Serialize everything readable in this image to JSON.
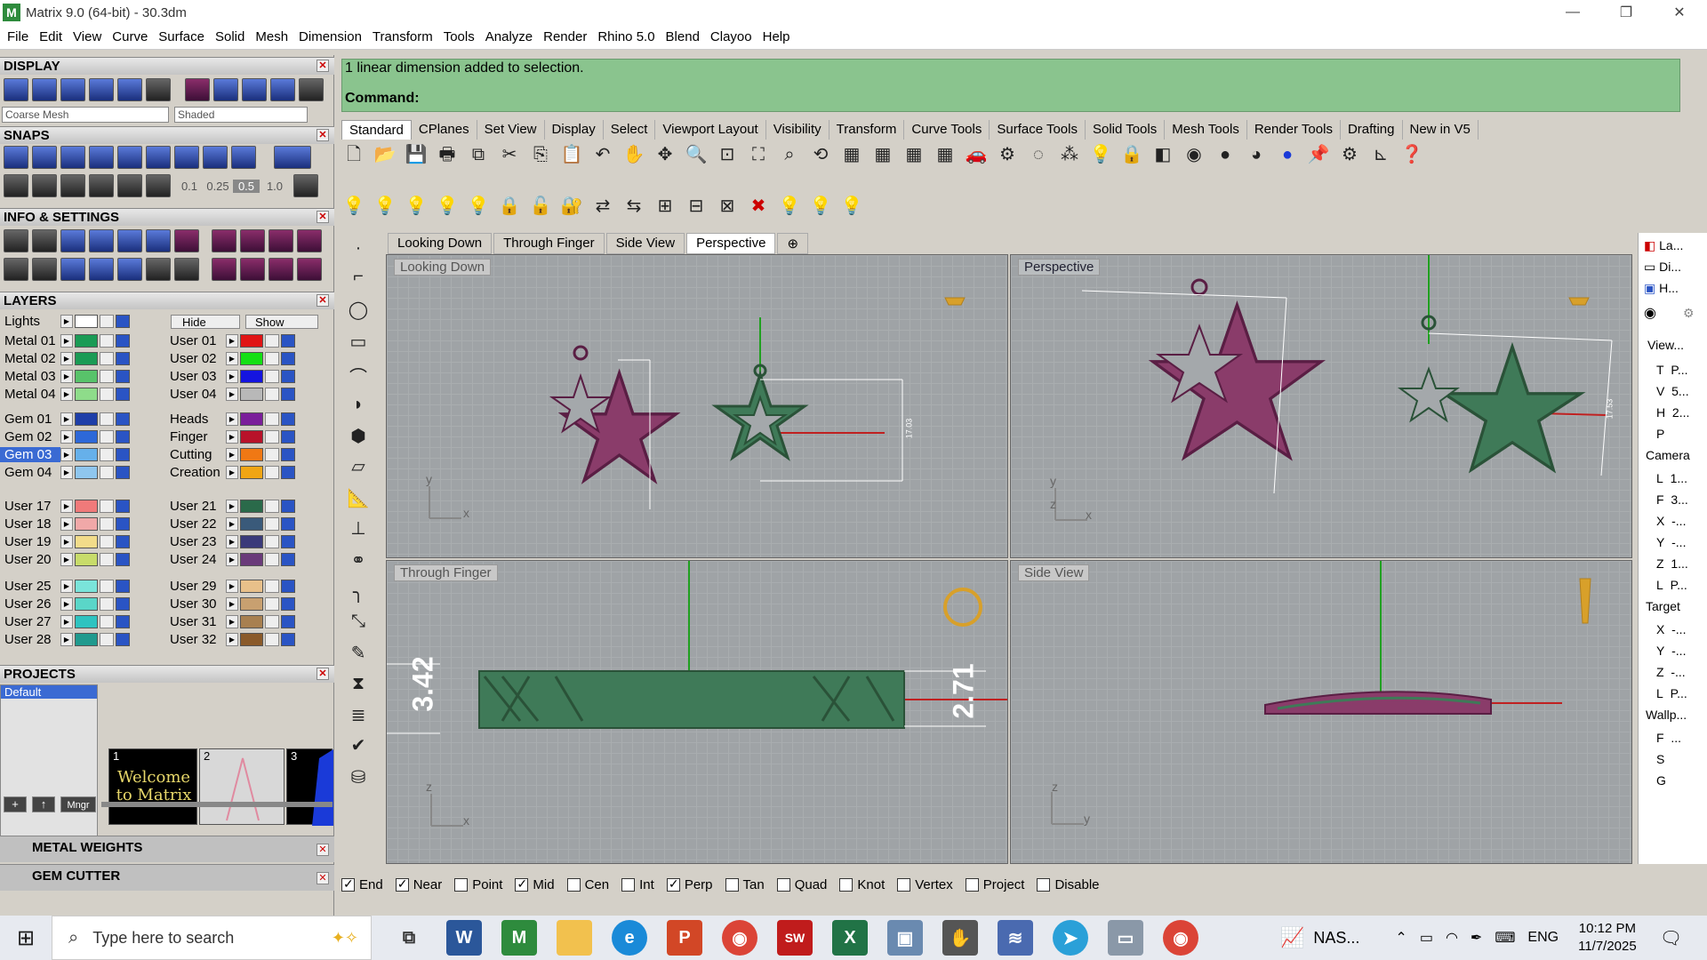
{
  "window": {
    "title": "Matrix 9.0 (64-bit) - 30.3dm",
    "min": "—",
    "max": "❐",
    "close": "✕"
  },
  "menu": [
    "File",
    "Edit",
    "View",
    "Curve",
    "Surface",
    "Solid",
    "Mesh",
    "Dimension",
    "Transform",
    "Tools",
    "Analyze",
    "Render",
    "Rhino 5.0",
    "Blend",
    "Clayoo",
    "Help"
  ],
  "panel": {
    "display": "DISPLAY",
    "mesh_select": "Coarse Mesh",
    "shade_select": "Shaded",
    "snaps": "SNAPS",
    "snap_values": [
      "0.1",
      "0.25",
      "0.5",
      "1.0"
    ],
    "info": "INFO & SETTINGS",
    "layers": "LAYERS",
    "lights": "Lights",
    "hide": "Hide",
    "show": "Show",
    "layers_left": [
      {
        "name": "Metal 01",
        "color": "#1a9b55"
      },
      {
        "name": "Metal 02",
        "color": "#1a9b55"
      },
      {
        "name": "Metal 03",
        "color": "#58c36a"
      },
      {
        "name": "Metal 04",
        "color": "#8edc8a"
      },
      {
        "name": "Gem 01",
        "color": "#1e3ea8"
      },
      {
        "name": "Gem 02",
        "color": "#2d68d8"
      },
      {
        "name": "Gem 03",
        "color": "#66b0ea"
      },
      {
        "name": "Gem 04",
        "color": "#8fc6ee"
      },
      {
        "name": "User 17",
        "color": "#f07a7a"
      },
      {
        "name": "User 18",
        "color": "#f0a8a8"
      },
      {
        "name": "User 19",
        "color": "#f2dc8a"
      },
      {
        "name": "User 20",
        "color": "#c8dc6a"
      },
      {
        "name": "User 25",
        "color": "#7ae4da"
      },
      {
        "name": "User 26",
        "color": "#5ad6c8"
      },
      {
        "name": "User 27",
        "color": "#2ec3c0"
      },
      {
        "name": "User 28",
        "color": "#209a8e"
      }
    ],
    "layers_right": [
      {
        "name": "User 01",
        "color": "#e01414"
      },
      {
        "name": "User 02",
        "color": "#14e014"
      },
      {
        "name": "User 03",
        "color": "#1414e0"
      },
      {
        "name": "User 04",
        "color": "#b8b8b8"
      },
      {
        "name": "Heads",
        "color": "#7a1e9a"
      },
      {
        "name": "Finger",
        "color": "#b8122a"
      },
      {
        "name": "Cutting",
        "color": "#f07814"
      },
      {
        "name": "Creation",
        "color": "#f0a514"
      },
      {
        "name": "User 21",
        "color": "#2a6a4a"
      },
      {
        "name": "User 22",
        "color": "#3a5a7a"
      },
      {
        "name": "User 23",
        "color": "#3a3a7a"
      },
      {
        "name": "User 24",
        "color": "#6a3a7a"
      },
      {
        "name": "User 29",
        "color": "#e8c08a"
      },
      {
        "name": "User 30",
        "color": "#c8a070"
      },
      {
        "name": "User 31",
        "color": "#a88050"
      },
      {
        "name": "User 32",
        "color": "#8a5a2a"
      }
    ],
    "projects": "PROJECTS",
    "project_default": "Default",
    "thumb1_num": "1",
    "thumb1_text": "Welcome to Matrix",
    "thumb2_num": "2",
    "thumb3_num": "3",
    "mngr": "Mngr",
    "metal_weights": "METAL WEIGHTS",
    "gem_cutter": "GEM CUTTER"
  },
  "command": {
    "history": "1 linear dimension added to selection.",
    "prompt": "Command:"
  },
  "tabs": [
    "Standard",
    "CPlanes",
    "Set View",
    "Display",
    "Select",
    "Viewport Layout",
    "Visibility",
    "Transform",
    "Curve Tools",
    "Surface Tools",
    "Solid Tools",
    "Mesh Tools",
    "Render Tools",
    "Drafting",
    "New in V5"
  ],
  "viewport_tabs": [
    "Looking Down",
    "Through Finger",
    "Side View",
    "Perspective"
  ],
  "viewport_tab_add": "⊕",
  "viewports": {
    "top_left": "Looking Down",
    "top_right": "Perspective",
    "bottom_left": "Through Finger",
    "bottom_right": "Side View"
  },
  "dims": {
    "left": "3.42",
    "right": "2.71",
    "small1": "17.03",
    "small2": "17.53"
  },
  "axes": {
    "x": "x",
    "y": "y",
    "z": "z"
  },
  "right_panel": {
    "tabs": [
      "La...",
      "Di...",
      "H..."
    ],
    "view": "View...",
    "view_rows": [
      {
        "k": "T",
        "v": "P..."
      },
      {
        "k": "V",
        "v": "5..."
      },
      {
        "k": "H",
        "v": "2..."
      },
      {
        "k": "P",
        "v": ""
      }
    ],
    "camera": "Camera",
    "camera_rows": [
      {
        "k": "L",
        "v": "1..."
      },
      {
        "k": "F",
        "v": "3..."
      },
      {
        "k": "X",
        "v": "-..."
      },
      {
        "k": "Y",
        "v": "-..."
      },
      {
        "k": "Z",
        "v": "1..."
      },
      {
        "k": "L",
        "v": "P..."
      }
    ],
    "target": "Target",
    "target_rows": [
      {
        "k": "X",
        "v": "-..."
      },
      {
        "k": "Y",
        "v": "-..."
      },
      {
        "k": "Z",
        "v": "-..."
      },
      {
        "k": "L",
        "v": "P..."
      }
    ],
    "wallp": "Wallp...",
    "wallp_rows": [
      {
        "k": "F",
        "v": "..."
      },
      {
        "k": "S",
        "v": ""
      },
      {
        "k": "G",
        "v": ""
      }
    ]
  },
  "snaps": [
    {
      "label": "End",
      "on": true
    },
    {
      "label": "Near",
      "on": true
    },
    {
      "label": "Point",
      "on": false
    },
    {
      "label": "Mid",
      "on": true
    },
    {
      "label": "Cen",
      "on": false
    },
    {
      "label": "Int",
      "on": false
    },
    {
      "label": "Perp",
      "on": true
    },
    {
      "label": "Tan",
      "on": false
    },
    {
      "label": "Quad",
      "on": false
    },
    {
      "label": "Knot",
      "on": false
    },
    {
      "label": "Vertex",
      "on": false
    },
    {
      "label": "Project",
      "on": false
    },
    {
      "label": "Disable",
      "on": false
    }
  ],
  "taskbar": {
    "search_placeholder": "Type here to search",
    "nas": "NAS...",
    "lang": "ENG",
    "time": "10:12 PM",
    "date": "11/7/2025"
  },
  "colors": {
    "star_purple": "#8a3c6a",
    "star_green": "#3f7a58",
    "cmd_green": "#8ac48e",
    "x_axis": "#c02020",
    "y_axis": "#20a020"
  }
}
